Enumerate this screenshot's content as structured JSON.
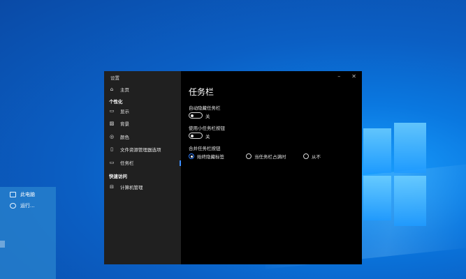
{
  "desktop": {
    "context_menu": [
      {
        "label": "此电脑",
        "icon": "computer-icon"
      },
      {
        "label": "运行...",
        "icon": "run-icon"
      }
    ]
  },
  "window": {
    "title": "设置",
    "controls": {
      "minimize": "–",
      "close": "✕"
    }
  },
  "sidebar": {
    "home": {
      "label": "主页",
      "icon": "home-icon"
    },
    "section_personalize": "个性化",
    "items": [
      {
        "label": "显示",
        "icon": "monitor-icon"
      },
      {
        "label": "背景",
        "icon": "image-icon"
      },
      {
        "label": "颜色",
        "icon": "palette-icon"
      },
      {
        "label": "文件资源管理器选项",
        "icon": "phone-icon"
      },
      {
        "label": "任务栏",
        "icon": "taskbar-icon"
      }
    ],
    "section_quick": "快速访问",
    "quick_items": [
      {
        "label": "计算机管理",
        "icon": "computer-management-icon"
      }
    ]
  },
  "main": {
    "title": "任务栏",
    "settings": [
      {
        "label": "自动隐藏任务栏",
        "state": "关"
      },
      {
        "label": "使用小任务栏按钮",
        "state": "关"
      }
    ],
    "merge": {
      "label": "合并任务栏按钮",
      "options": [
        "始终隐藏标签",
        "当任务栏占满时",
        "从不"
      ],
      "selected": "始终隐藏标签"
    }
  },
  "colors": {
    "accent": "#2f7dff",
    "sidebar_bg": "#202020",
    "content_bg": "#000000"
  }
}
